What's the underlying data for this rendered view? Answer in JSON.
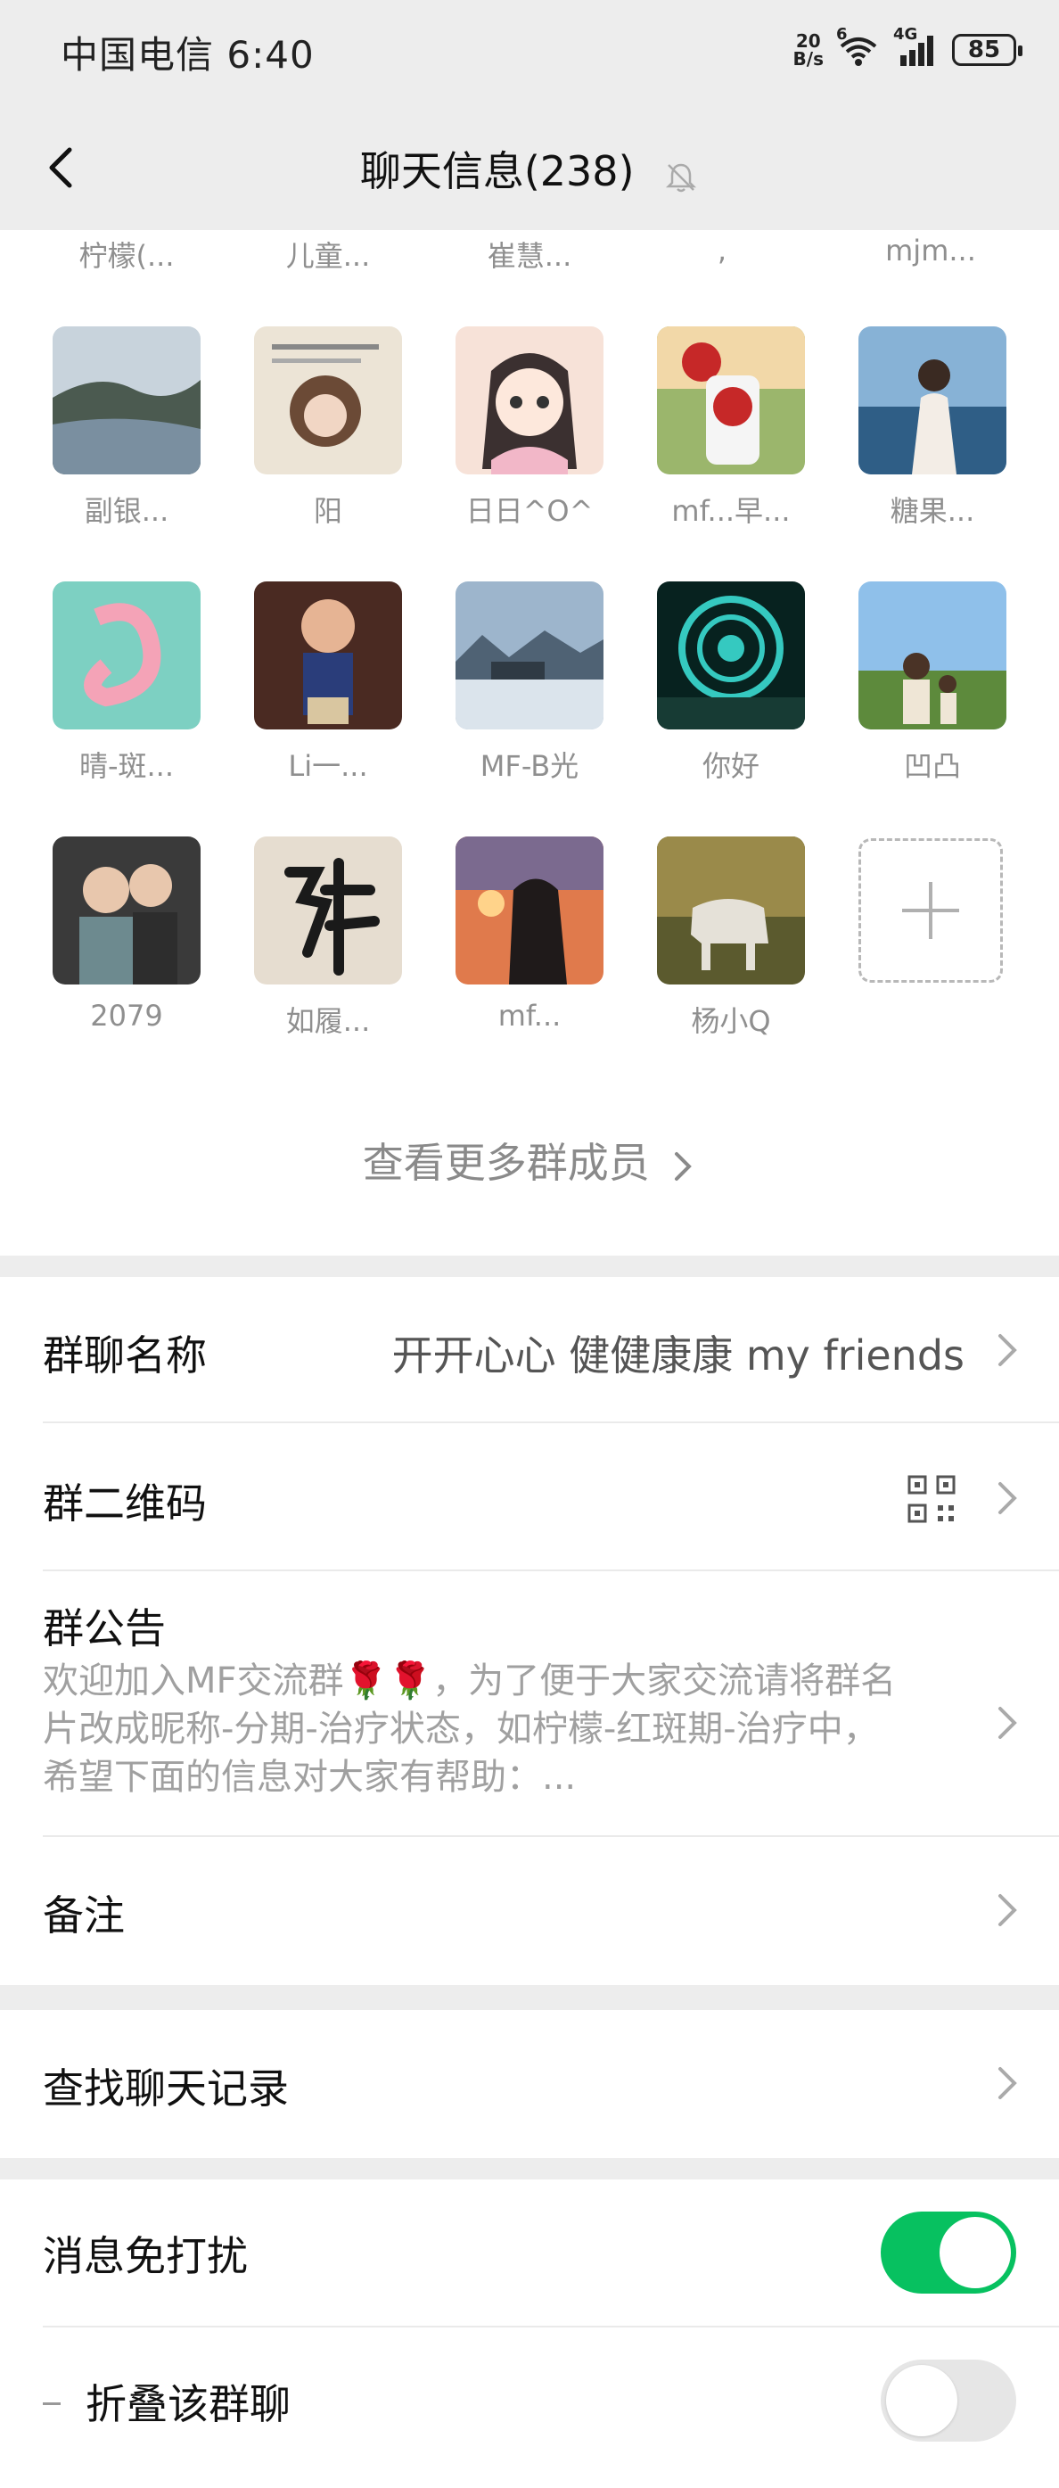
{
  "status_bar": {
    "carrier_time": "中国电信 6:40",
    "net_speed_value": "20",
    "net_speed_unit": "B/s",
    "wifi_sup": "6",
    "signal_label": "4G",
    "battery": "85"
  },
  "nav": {
    "title": "聊天信息(238)"
  },
  "members": {
    "top_names": [
      "柠檬(...",
      "儿童...",
      "崔慧...",
      ",",
      "mjm..."
    ],
    "rows": [
      [
        "副银...",
        "阳",
        "日日^O^",
        "mf...早...",
        "糖果..."
      ],
      [
        "晴-斑...",
        "Li一...",
        "MF-B光",
        "你好",
        "凹凸"
      ],
      [
        "2079",
        "如履...",
        "mf...",
        "杨小Q"
      ]
    ],
    "more_label": "查看更多群成员"
  },
  "settings": {
    "group_name_label": "群聊名称",
    "group_name_value": "开开心心 健健康康 my friends",
    "qr_label": "群二维码",
    "notice_label": "群公告",
    "notice_line1": "欢迎加入MF交流群🌹🌹，为了便于大家交流请将群名",
    "notice_line2": "片改成昵称-分期-治疗状态，如柠檬-红斑期-治疗中，",
    "notice_line3": "希望下面的信息对大家有帮助：...",
    "remark_label": "备注",
    "search_label": "查找聊天记录",
    "mute_label": "消息免打扰",
    "fold_label": "折叠该群聊"
  },
  "colors": {
    "toggle_on": "#07c160",
    "toggle_off": "#e6e6e6",
    "background": "#ededed"
  }
}
